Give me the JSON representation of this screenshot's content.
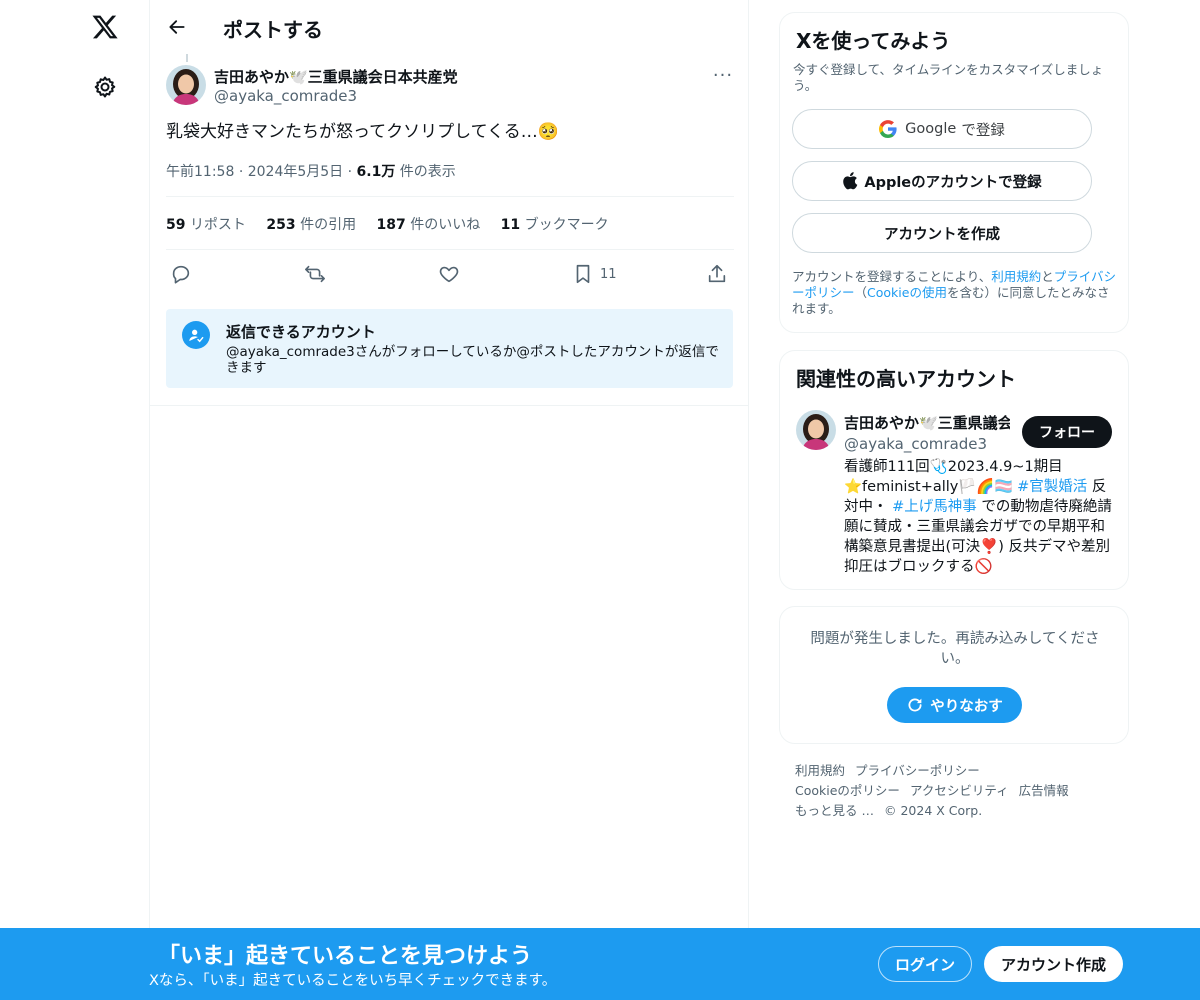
{
  "colors": {
    "accent": "#1d9bf0",
    "text": "#0f1419",
    "muted": "#536471",
    "border": "#eff3f4",
    "reply_bg": "#e8f5fd"
  },
  "nav": {
    "logo_icon": "x-logo-icon",
    "settings_icon": "gear-icon"
  },
  "header": {
    "back_icon": "arrow-left-icon",
    "title": "ポストする"
  },
  "post": {
    "author_name": "吉田あやか🕊️三重県議会日本共産党",
    "author_handle": "@ayaka_comrade3",
    "more_label": "···",
    "text": "乳袋大好きマンたちが怒ってクソリプしてくる…🥺",
    "time": "午前11:58",
    "date": "2024年5月5日",
    "views_count": "6.1万",
    "views_label": "件の表示",
    "sep": "·",
    "stats": {
      "reposts": {
        "count": "59",
        "label": "リポスト"
      },
      "quotes": {
        "count": "253",
        "label": "件の引用"
      },
      "likes": {
        "count": "187",
        "label": "件のいいね"
      },
      "bookmarks": {
        "count": "11",
        "label": "ブックマーク"
      }
    },
    "actions": {
      "bookmark_count": "11"
    }
  },
  "reply_info": {
    "title": "返信できるアカウント",
    "description": "@ayaka_comrade3さんがフォローしているか@ポストしたアカウントが返信できます"
  },
  "signup": {
    "title": "Xを使ってみよう",
    "subtitle": "今すぐ登録して、タイムラインをカスタマイズしましょう。",
    "google_brand": "Google",
    "google_suffix": "で登録",
    "apple_label": "Appleのアカウントで登録",
    "create_label": "アカウントを作成",
    "terms_prefix": "アカウントを登録することにより、",
    "terms_link": "利用規約",
    "terms_and": "と",
    "privacy_link": "プライバシーポリシー",
    "paren_open": "（",
    "cookie_link": "Cookieの使用",
    "terms_suffix": "を含む）に同意したとみなされます。"
  },
  "related": {
    "title": "関連性の高いアカウント",
    "name": "吉田あやか🕊️三重県議会日本共産党",
    "handle": "@ayaka_comrade3",
    "follow_label": "フォロー",
    "bio_part1": "看護師111回🩺2023.4.9~1期目⭐feminist+ally🏳️🌈🏳️‍⚧️ ",
    "bio_tag1": "#官製婚活",
    "bio_part2": " 反対中・ ",
    "bio_tag2": "#上げ馬神事",
    "bio_part3": " での動物虐待廃絶請願に賛成・三重県議会ガザでの早期平和構築意見書提出(可決❣️) 反共デマや差別抑圧はブロックする🚫"
  },
  "error": {
    "message": "問題が発生しました。再読み込みしてください。",
    "retry_label": "やりなおす"
  },
  "footer": {
    "terms": "利用規約",
    "privacy": "プライバシーポリシー",
    "cookie": "Cookieのポリシー",
    "accessibility": "アクセシビリティ",
    "ads": "広告情報",
    "more": "もっと見る …",
    "copyright": "© 2024 X Corp."
  },
  "banner": {
    "title": "「いま」起きていることを見つけよう",
    "subtitle": "Xなら、「いま」起きていることをいち早くチェックできます。",
    "login_label": "ログイン",
    "create_label": "アカウント作成"
  }
}
